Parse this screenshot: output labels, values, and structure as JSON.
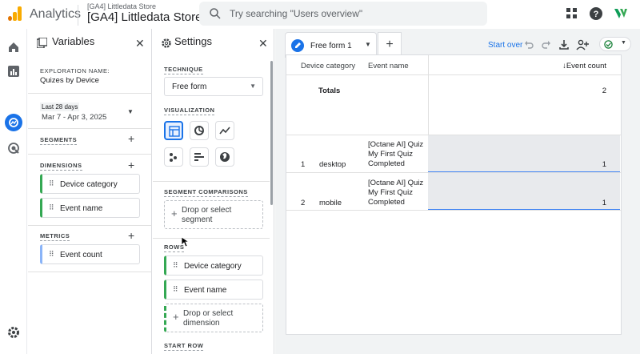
{
  "header": {
    "app_name": "Analytics",
    "account_small": "[GA4] Littledata Store",
    "account_big": "[GA4] Littledata Store",
    "search_placeholder": "Try searching \"Users overview\""
  },
  "variables": {
    "title": "Variables",
    "exploration_label": "EXPLORATION NAME:",
    "exploration_name": "Quizes by Device",
    "date_label": "Last 28 days",
    "date_range": "Mar 7 - Apr 3, 2025",
    "segments_label": "SEGMENTS",
    "dimensions_label": "DIMENSIONS",
    "dimensions": [
      "Device category",
      "Event name"
    ],
    "metrics_label": "METRICS",
    "metrics": [
      "Event count"
    ]
  },
  "settings": {
    "title": "Settings",
    "technique_label": "TECHNIQUE",
    "technique_value": "Free form",
    "visualization_label": "VISUALIZATION",
    "segment_comparisons_label": "SEGMENT COMPARISONS",
    "segment_drop": [
      "Drop or select",
      "segment"
    ],
    "rows_label": "ROWS",
    "rows": [
      "Device category",
      "Event name"
    ],
    "dimension_drop": [
      "Drop or select",
      "dimension"
    ],
    "start_row_label": "START ROW"
  },
  "canvas": {
    "tab_name": "Free form 1",
    "start_over": "Start over",
    "columns": [
      "Device category",
      "Event name",
      "↓Event count"
    ],
    "totals_label": "Totals",
    "totals_value": "2",
    "rows": [
      {
        "index": "1",
        "device": "desktop",
        "event_lines": [
          "[Octane AI] Quiz",
          "My First Quiz",
          "Completed"
        ],
        "count": "1"
      },
      {
        "index": "2",
        "device": "mobile",
        "event_lines": [
          "[Octane AI] Quiz",
          "My First Quiz",
          "Completed"
        ],
        "count": "1"
      }
    ]
  },
  "colors": {
    "accent": "#1a73e8",
    "dimension_chip": "#34a853",
    "metric_chip": "#8ab4f8",
    "logo_orange": "#f9ab00",
    "logo_dark_orange": "#e37400"
  }
}
